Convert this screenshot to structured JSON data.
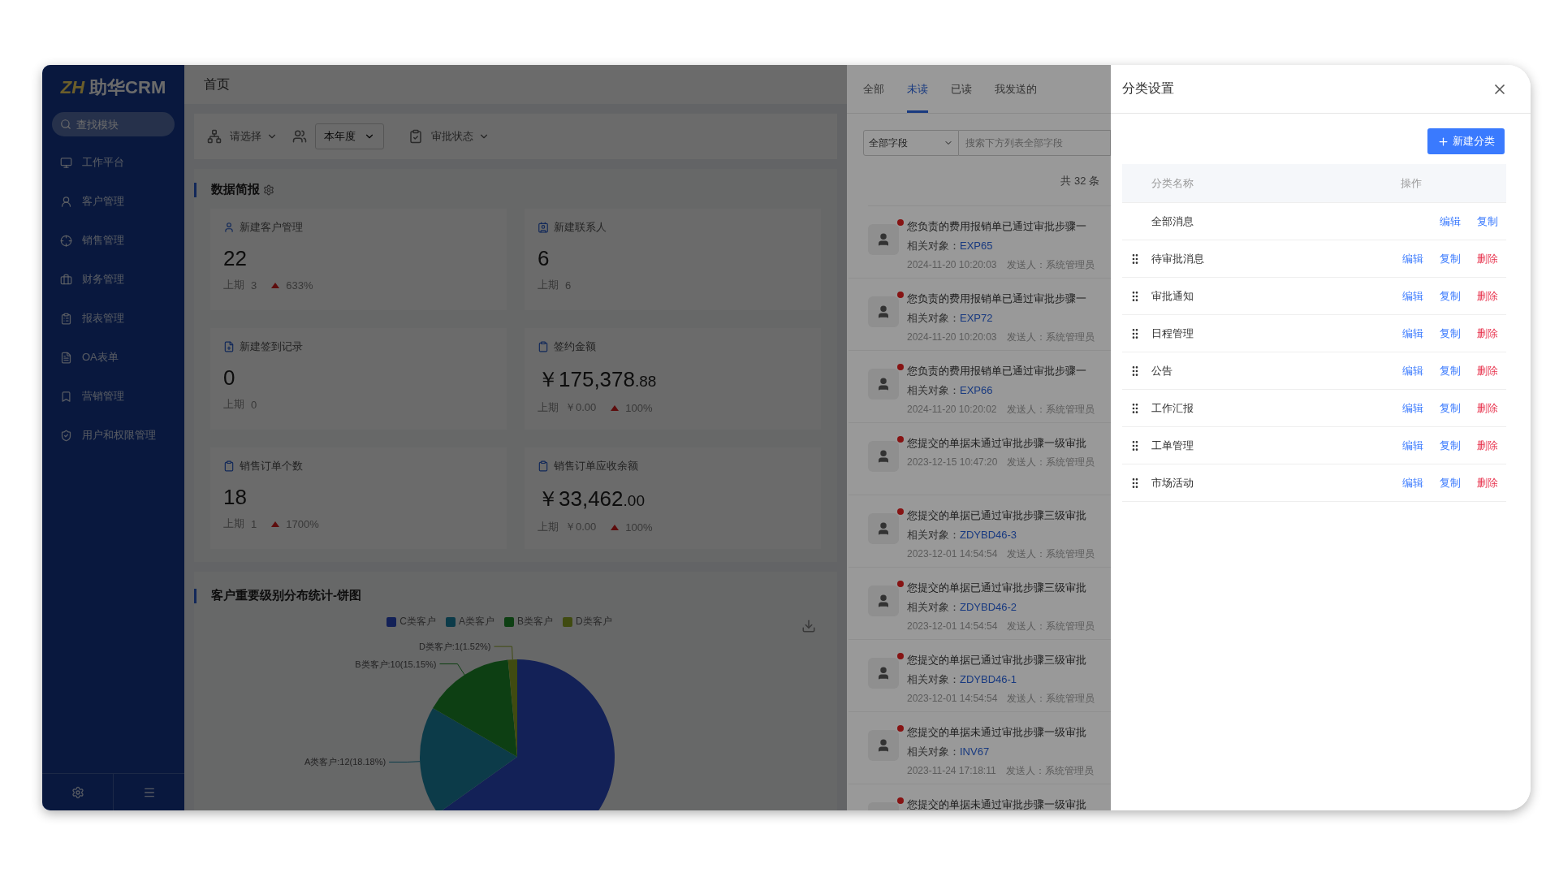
{
  "sidebar": {
    "logo_mark": "ZH",
    "brand": "助华CRM",
    "search": {
      "placeholder": "查找模块"
    },
    "items": [
      {
        "label": "工作平台"
      },
      {
        "label": "客户管理"
      },
      {
        "label": "销售管理"
      },
      {
        "label": "财务管理"
      },
      {
        "label": "报表管理"
      },
      {
        "label": "OA表单"
      },
      {
        "label": "营销管理"
      },
      {
        "label": "用户和权限管理"
      }
    ]
  },
  "main": {
    "breadcrumb": "首页",
    "filters": {
      "scope": {
        "placeholder": "请选择"
      },
      "period": {
        "value": "本年度"
      },
      "approval": {
        "placeholder": "审批状态"
      }
    },
    "brief": {
      "title": "数据简报",
      "cards": [
        {
          "title": "新建客户管理",
          "value": "22",
          "prev_label": "上期",
          "prev_value": "3",
          "up": true,
          "change": "633%"
        },
        {
          "title": "新建联系人",
          "value": "6",
          "prev_label": "上期",
          "prev_value": "6"
        },
        {
          "title": "新建签到记录",
          "value": "0",
          "prev_label": "上期",
          "prev_value": "0"
        },
        {
          "title": "签约金额",
          "value": "￥175,378",
          "decimals": ".88",
          "prev_label": "上期",
          "prev_value": "￥0.00",
          "up": true,
          "change": "100%"
        },
        {
          "title": "销售订单个数",
          "value": "18",
          "prev_label": "上期",
          "prev_value": "1",
          "up": true,
          "change": "1700%"
        },
        {
          "title": "销售订单应收余额",
          "value": "￥33,462",
          "decimals": ".00",
          "prev_label": "上期",
          "prev_value": "￥0.00",
          "up": true,
          "change": "100%"
        }
      ]
    },
    "distribution": {
      "title": "客户重要级别分布统计-饼图",
      "chart_data": {
        "type": "pie",
        "categories": [
          "C类客户",
          "A类客户",
          "B类客户",
          "D类客户"
        ],
        "values": [
          43,
          12,
          10,
          1
        ],
        "colors": [
          "#3050d0",
          "#1f8fb0",
          "#22992e",
          "#9bb52a"
        ],
        "value_labels": [
          null,
          "A类客户:12(18.18%)",
          "B类客户:10(15.15%)",
          "D类客户:1(1.52%)"
        ]
      }
    }
  },
  "messages": {
    "tabs": [
      {
        "label": "全部",
        "selected": false
      },
      {
        "label": "未读",
        "selected": true
      },
      {
        "label": "已读",
        "selected": false
      },
      {
        "label": "我发送的",
        "selected": false
      }
    ],
    "field_select": {
      "value": "全部字段"
    },
    "search": {
      "placeholder": "搜索下方列表全部字段"
    },
    "total": "共 32 条",
    "items": [
      {
        "unread": true,
        "title": "您负责的费用报销单已通过审批步骤一",
        "object_label": "相关对象：",
        "object": "EXP65",
        "time": "2024-11-20 10:20:03",
        "sender": "发送人：系统管理员"
      },
      {
        "unread": true,
        "title": "您负责的费用报销单已通过审批步骤一",
        "object_label": "相关对象：",
        "object": "EXP72",
        "time": "2024-11-20 10:20:03",
        "sender": "发送人：系统管理员"
      },
      {
        "unread": true,
        "title": "您负责的费用报销单已通过审批步骤一",
        "object_label": "相关对象：",
        "object": "EXP66",
        "time": "2024-11-20 10:20:02",
        "sender": "发送人：系统管理员"
      },
      {
        "unread": true,
        "title": "您提交的单据未通过审批步骤一级审批",
        "time": "2023-12-15 10:47:20",
        "sender": "发送人：系统管理员"
      },
      {
        "unread": true,
        "title": "您提交的单据已通过审批步骤三级审批",
        "object_label": "相关对象：",
        "object": "ZDYBD46-3",
        "time": "2023-12-01 14:54:54",
        "sender": "发送人：系统管理员"
      },
      {
        "unread": true,
        "title": "您提交的单据已通过审批步骤三级审批",
        "object_label": "相关对象：",
        "object": "ZDYBD46-2",
        "time": "2023-12-01 14:54:54",
        "sender": "发送人：系统管理员"
      },
      {
        "unread": true,
        "title": "您提交的单据已通过审批步骤三级审批",
        "object_label": "相关对象：",
        "object": "ZDYBD46-1",
        "time": "2023-12-01 14:54:54",
        "sender": "发送人：系统管理员"
      },
      {
        "unread": true,
        "title": "您提交的单据未通过审批步骤一级审批",
        "object_label": "相关对象：",
        "object": "INV67",
        "time": "2023-11-24 17:18:11",
        "sender": "发送人：系统管理员"
      },
      {
        "unread": true,
        "title": "您提交的单据未通过审批步骤一级审批"
      }
    ]
  },
  "drawer": {
    "title": "分类设置",
    "new_button": "新建分类",
    "columns": [
      "分类名称",
      "操作"
    ],
    "rows": [
      {
        "name": "全部消息",
        "draggable": false,
        "actions": [
          {
            "kind": "edit",
            "label": "编辑"
          },
          {
            "kind": "copy",
            "label": "复制"
          }
        ]
      },
      {
        "name": "待审批消息",
        "draggable": true,
        "actions": [
          {
            "kind": "edit",
            "label": "编辑"
          },
          {
            "kind": "copy",
            "label": "复制"
          },
          {
            "kind": "delete",
            "label": "删除"
          }
        ]
      },
      {
        "name": "审批通知",
        "draggable": true,
        "actions": [
          {
            "kind": "edit",
            "label": "编辑"
          },
          {
            "kind": "copy",
            "label": "复制"
          },
          {
            "kind": "delete",
            "label": "删除"
          }
        ]
      },
      {
        "name": "日程管理",
        "draggable": true,
        "actions": [
          {
            "kind": "edit",
            "label": "编辑"
          },
          {
            "kind": "copy",
            "label": "复制"
          },
          {
            "kind": "delete",
            "label": "删除"
          }
        ]
      },
      {
        "name": "公告",
        "draggable": true,
        "actions": [
          {
            "kind": "edit",
            "label": "编辑"
          },
          {
            "kind": "copy",
            "label": "复制"
          },
          {
            "kind": "delete",
            "label": "删除"
          }
        ]
      },
      {
        "name": "工作汇报",
        "draggable": true,
        "actions": [
          {
            "kind": "edit",
            "label": "编辑"
          },
          {
            "kind": "copy",
            "label": "复制"
          },
          {
            "kind": "delete",
            "label": "删除"
          }
        ]
      },
      {
        "name": "工单管理",
        "draggable": true,
        "actions": [
          {
            "kind": "edit",
            "label": "编辑"
          },
          {
            "kind": "copy",
            "label": "复制"
          },
          {
            "kind": "delete",
            "label": "删除"
          }
        ]
      },
      {
        "name": "市场活动",
        "draggable": true,
        "actions": [
          {
            "kind": "edit",
            "label": "编辑"
          },
          {
            "kind": "copy",
            "label": "复制"
          },
          {
            "kind": "delete",
            "label": "删除"
          }
        ]
      }
    ]
  }
}
